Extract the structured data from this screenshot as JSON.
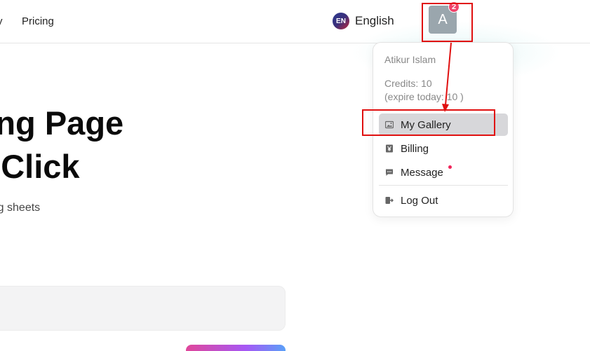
{
  "header": {
    "nav": [
      "y",
      "Pricing"
    ],
    "language": {
      "code": "EN",
      "label": "English"
    },
    "avatar": {
      "initial": "A",
      "notification_count": "2"
    }
  },
  "hero": {
    "title_line1": "ring Page",
    "title_line2": "e Click",
    "subtitle": "uring sheets"
  },
  "user_menu": {
    "user_name": "Atikur Islam",
    "credits": "Credits: 10",
    "expire": "(expire today: 10 )",
    "items": [
      {
        "label": "My Gallery",
        "icon": "gallery-icon",
        "active": true
      },
      {
        "label": "Billing",
        "icon": "billing-icon"
      },
      {
        "label": "Message",
        "icon": "message-icon",
        "has_unread_dot": true
      },
      {
        "label": "Log Out",
        "icon": "logout-icon"
      }
    ]
  },
  "colors": {
    "annotation": "#e01010",
    "badge": "#f0436b",
    "active_item": "#d7d7da"
  }
}
